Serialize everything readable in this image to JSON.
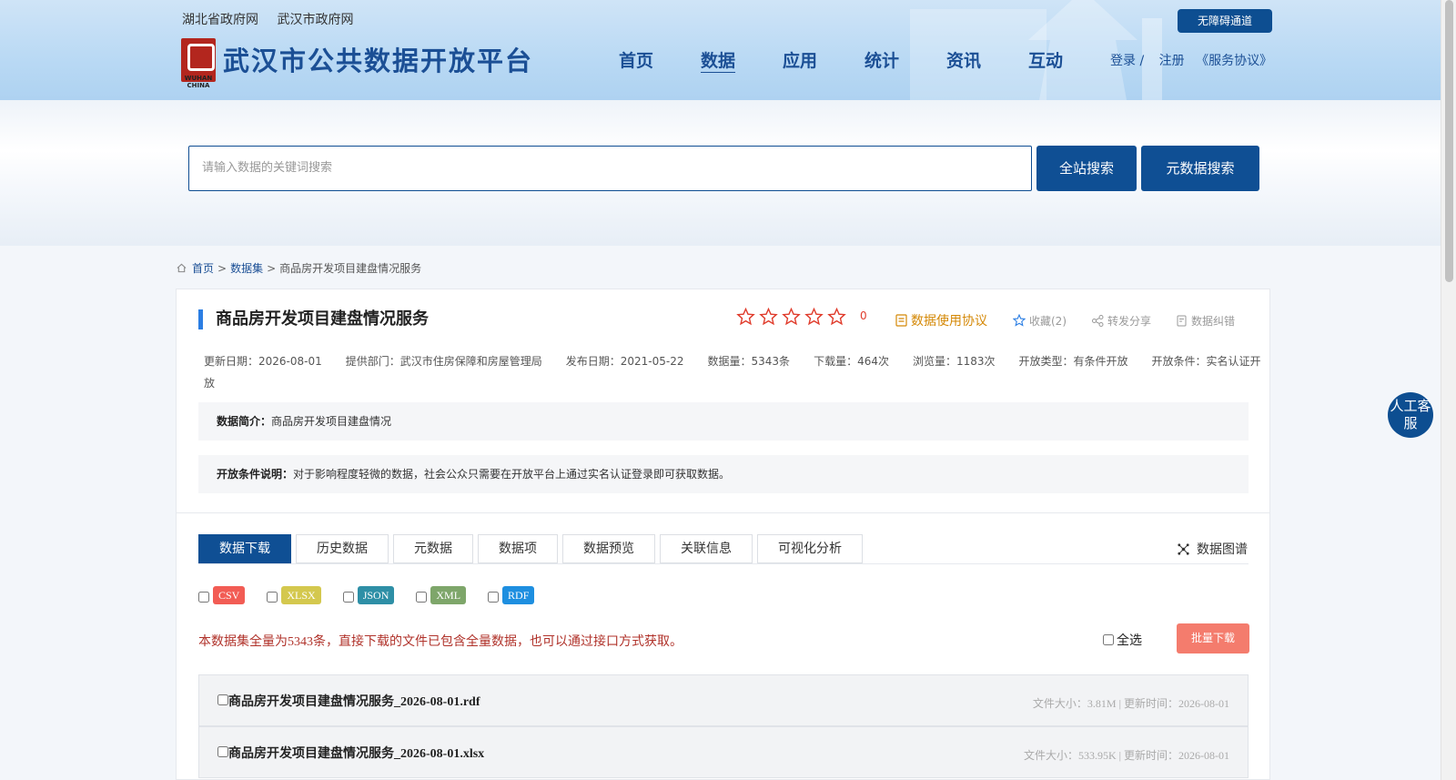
{
  "header": {
    "gov_links": [
      "湖北省政府网",
      "武汉市政府网"
    ],
    "accessibility": "无障碍通道",
    "logo_sub": "WUHAN CHINA",
    "site_title": "武汉市公共数据开放平台",
    "nav": [
      {
        "label": "首页",
        "active": false
      },
      {
        "label": "数据",
        "active": true
      },
      {
        "label": "应用",
        "active": false
      },
      {
        "label": "统计",
        "active": false
      },
      {
        "label": "资讯",
        "active": false
      },
      {
        "label": "互动",
        "active": false
      }
    ],
    "login": "登录 /",
    "register": "注册",
    "agreement": "《服务协议》"
  },
  "search": {
    "placeholder": "请输入数据的关键词搜索",
    "btn_all": "全站搜索",
    "btn_meta": "元数据搜索"
  },
  "breadcrumb": {
    "home": "首页",
    "dataset": "数据集",
    "current": "商品房开发项目建盘情况服务",
    "sep": ">"
  },
  "dataset": {
    "title": "商品房开发项目建盘情况服务",
    "rating": "0",
    "rating_stars": 0,
    "actions": {
      "agreement": "数据使用协议",
      "favorite": "收藏(2)",
      "share": "转发分享",
      "correction": "数据纠错"
    },
    "meta": [
      "更新日期：2026-08-01",
      "提供部门：武汉市住房保障和房屋管理局",
      "发布日期：2021-05-22",
      "数据量：5343条",
      "下载量：464次",
      "浏览量：1183次",
      "开放类型：有条件开放",
      "开放条件：实名认证开放"
    ],
    "intro_label": "数据简介：",
    "intro": "商品房开发项目建盘情况",
    "condition_label": "开放条件说明：",
    "condition": "对于影响程度轻微的数据，社会公众只需要在开放平台上通过实名认证登录即可获取数据。"
  },
  "tabs": [
    "数据下载",
    "历史数据",
    "元数据",
    "数据项",
    "数据预览",
    "关联信息",
    "可视化分析"
  ],
  "graph_link": "数据图谱",
  "formats": [
    {
      "label": "CSV",
      "color": "#f25c54"
    },
    {
      "label": "XLSX",
      "color": "#d4c84e"
    },
    {
      "label": "JSON",
      "color": "#2e8fa6"
    },
    {
      "label": "XML",
      "color": "#7ea66a"
    },
    {
      "label": "RDF",
      "color": "#1e8fe0"
    }
  ],
  "notice": "本数据集全量为5343条，直接下载的文件已包含全量数据，也可以通过接口方式获取。",
  "select_all": "全选",
  "batch_download": "批量下载",
  "files": [
    {
      "name": "商品房开发项目建盘情况服务_2026-08-01.rdf",
      "meta": "文件大小：3.81M | 更新时间：2026-08-01"
    },
    {
      "name": "商品房开发项目建盘情况服务_2026-08-01.xlsx",
      "meta": "文件大小：533.95K | 更新时间：2026-08-01"
    }
  ],
  "service": "人工客服",
  "colors": {
    "primary": "#0f4f94",
    "accent_red": "#e03c2c",
    "batch_btn": "#f47c6d"
  }
}
